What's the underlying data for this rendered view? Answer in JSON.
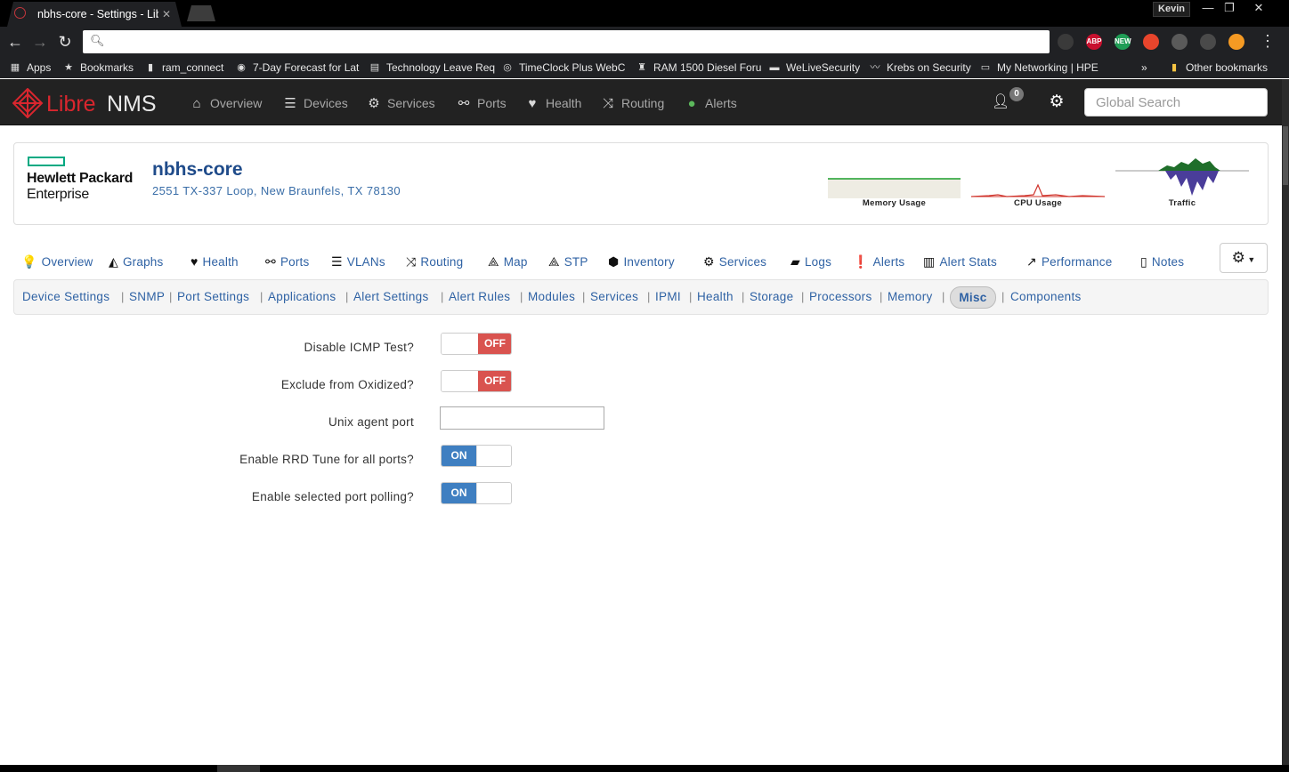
{
  "browser": {
    "tab_title": "nbhs-core - Settings - LibreNMS",
    "tab_close": "✕",
    "profile_name": "Kevin",
    "window_controls": {
      "minimize": "—",
      "maximize": "❐",
      "close": "✕"
    },
    "address_value": "",
    "extensions": [
      {
        "name": "ghostery-icon",
        "label": "",
        "color": "#3a3a3a"
      },
      {
        "name": "adblock-icon",
        "label": "ABP",
        "color": "#c8102e"
      },
      {
        "name": "new-badge-extension-icon",
        "label": "NEW",
        "color": "#1f9d55"
      },
      {
        "name": "stumbleupon-icon",
        "label": "",
        "color": "#e8452c"
      },
      {
        "name": "pdf-icon",
        "label": "",
        "color": "#5a5a5a"
      },
      {
        "name": "shield-extension-icon",
        "label": "",
        "color": "#4a4a4a"
      },
      {
        "name": "rss-icon",
        "label": "",
        "color": "#f59a23"
      }
    ],
    "bookmarks": [
      {
        "name": "bookmark-apps",
        "icon": "▦",
        "label": "Apps"
      },
      {
        "name": "bookmark-bookmarks",
        "icon": "★",
        "label": "Bookmarks"
      },
      {
        "name": "bookmark-ram-connect",
        "icon": "▮",
        "label": "ram_connect"
      },
      {
        "name": "bookmark-forecast",
        "icon": "◉",
        "label": "7-Day Forecast for Lat"
      },
      {
        "name": "bookmark-technology-leave",
        "icon": "▤",
        "label": "Technology Leave Req"
      },
      {
        "name": "bookmark-timeclock",
        "icon": "◎",
        "label": "TimeClock Plus WebC"
      },
      {
        "name": "bookmark-ram-1500",
        "icon": "♜",
        "label": "RAM 1500 Diesel Foru"
      },
      {
        "name": "bookmark-welivesecurity",
        "icon": "▬",
        "label": "WeLiveSecurity"
      },
      {
        "name": "bookmark-krebs",
        "icon": "〰",
        "label": "Krebs on Security"
      },
      {
        "name": "bookmark-my-networking",
        "icon": "▭",
        "label": "My Networking | HPE"
      }
    ],
    "bookmarks_more": "»",
    "other_bookmarks": "Other bookmarks"
  },
  "navbar": {
    "brand_libre": "Libre",
    "brand_nms": "NMS",
    "items": [
      {
        "label": "Overview",
        "icon": "⌂"
      },
      {
        "label": "Devices",
        "icon": "☰"
      },
      {
        "label": "Services",
        "icon": "⚙"
      },
      {
        "label": "Ports",
        "icon": "⚯"
      },
      {
        "label": "Health",
        "icon": "♥"
      },
      {
        "label": "Routing",
        "icon": "⤨"
      },
      {
        "label": "Alerts",
        "icon": "●"
      }
    ],
    "notification_count": "0",
    "search_placeholder": "Global Search",
    "alerts_icon_color": "#5cb85c"
  },
  "device": {
    "vendor_line1": "Hewlett Packard",
    "vendor_line2": "Enterprise",
    "hostname": "nbhs-core",
    "location": "2551 TX-337 Loop, New Braunfels, TX 78130",
    "graphs": [
      {
        "label": "Memory Usage"
      },
      {
        "label": "CPU Usage"
      },
      {
        "label": "Traffic"
      }
    ]
  },
  "device_tabs": [
    {
      "label": "Overview",
      "icon": "💡"
    },
    {
      "label": "Graphs",
      "icon": "◭"
    },
    {
      "label": "Health",
      "icon": "♥"
    },
    {
      "label": "Ports",
      "icon": "⚯"
    },
    {
      "label": "VLANs",
      "icon": "☰"
    },
    {
      "label": "Routing",
      "icon": "⤨"
    },
    {
      "label": "Map",
      "icon": "⟁"
    },
    {
      "label": "STP",
      "icon": "⟁"
    },
    {
      "label": "Inventory",
      "icon": "⬢"
    },
    {
      "label": "Services",
      "icon": "⚙"
    },
    {
      "label": "Logs",
      "icon": "▰"
    },
    {
      "label": "Alerts",
      "icon": "❗"
    },
    {
      "label": "Alert Stats",
      "icon": "▥"
    },
    {
      "label": "Performance",
      "icon": "↗"
    },
    {
      "label": "Notes",
      "icon": "▯"
    }
  ],
  "settings_tabs": [
    "Device Settings",
    "SNMP",
    "Port Settings",
    "Applications",
    "Alert Settings",
    "Alert Rules",
    "Modules",
    "Services",
    "IPMI",
    "Health",
    "Storage",
    "Processors",
    "Memory",
    "Misc",
    "Components"
  ],
  "settings_active": "Misc",
  "separator": "|",
  "form": {
    "fields": [
      {
        "label": "Disable ICMP Test?",
        "type": "toggle",
        "value": "OFF"
      },
      {
        "label": "Exclude from Oxidized?",
        "type": "toggle",
        "value": "OFF"
      },
      {
        "label": "Unix agent port",
        "type": "text",
        "value": ""
      },
      {
        "label": "Enable RRD Tune for all ports?",
        "type": "toggle",
        "value": "ON"
      },
      {
        "label": "Enable selected port polling?",
        "type": "toggle",
        "value": "ON"
      }
    ]
  },
  "colors": {
    "toggle_off": "#d9534f",
    "toggle_on": "#3f7fc1",
    "link": "#2f62a4",
    "hpe_green": "#01a982",
    "brand_red": "#d9262e"
  }
}
